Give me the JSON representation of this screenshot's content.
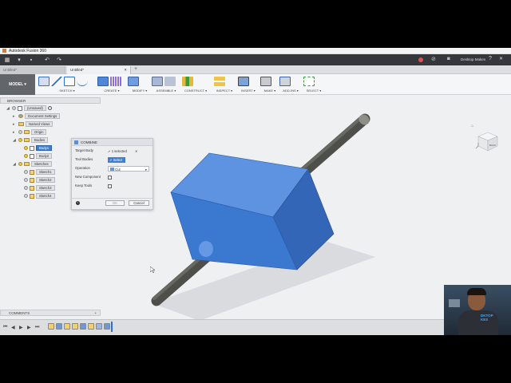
{
  "window": {
    "title": "Autodesk Fusion 360"
  },
  "quick_access": {
    "icons": [
      "grid-icon",
      "file-icon",
      "save-icon",
      "undo-icon",
      "redo-icon"
    ]
  },
  "header_right": {
    "label": "Desktop Makes"
  },
  "tabs": [
    {
      "label": "Untitled*",
      "active": false
    },
    {
      "label": "Untitled*",
      "active": true
    }
  ],
  "toolbar": {
    "workspace": "MODEL ▾",
    "groups": [
      {
        "label": "SKETCH ▾"
      },
      {
        "label": "CREATE ▾"
      },
      {
        "label": "MODIFY ▾"
      },
      {
        "label": "ASSEMBLE ▾"
      },
      {
        "label": "CONSTRUCT ▾"
      },
      {
        "label": "INSPECT ▾"
      },
      {
        "label": "INSERT ▾"
      },
      {
        "label": "MAKE ▾"
      },
      {
        "label": "ADD-INS ▾"
      },
      {
        "label": "SELECT ▾"
      }
    ]
  },
  "browser": {
    "title": "BROWSER",
    "items": [
      {
        "label": "(Unsaved)"
      },
      {
        "label": "Document Settings"
      },
      {
        "label": "Named Views"
      },
      {
        "label": "Origin"
      },
      {
        "label": "Bodies"
      },
      {
        "label": "Body1"
      },
      {
        "label": "Body2"
      },
      {
        "label": "Sketches"
      },
      {
        "label": "Sketch1"
      },
      {
        "label": "Sketch2"
      },
      {
        "label": "Sketch3"
      },
      {
        "label": "Sketch4"
      }
    ]
  },
  "combine_dialog": {
    "title": "COMBINE",
    "target_body_label": "Target Body",
    "target_body_value": "1 selected",
    "tool_bodies_label": "Tool Bodies",
    "tool_bodies_value": "Select",
    "operation_label": "Operation",
    "operation_value": "Cut",
    "new_component_label": "New Component",
    "keep_tools_label": "Keep Tools",
    "ok_label": "OK",
    "cancel_label": "Cancel"
  },
  "viewcube": {
    "face": "BACK"
  },
  "comments": {
    "title": "COMMENTS"
  },
  "webcam_overlay": {
    "text": "DKTOP\nKES"
  },
  "colors": {
    "body_blue": "#3b78d0",
    "rod_gray": "#5a5a55",
    "toolbar_dark": "#35373b"
  }
}
